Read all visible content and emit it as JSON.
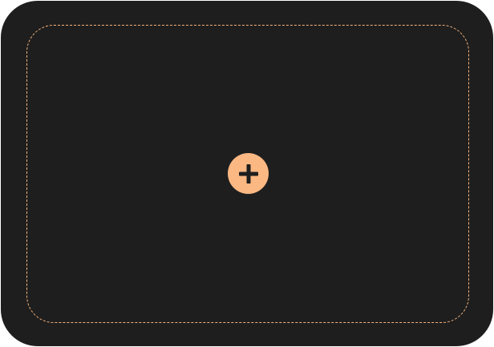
{
  "card": {
    "background": "#1e1e1e",
    "border_accent": "#f6b47f"
  },
  "add_button": {
    "icon": "plus-icon",
    "background": "#fcb883",
    "icon_color": "#1e1e1e"
  }
}
